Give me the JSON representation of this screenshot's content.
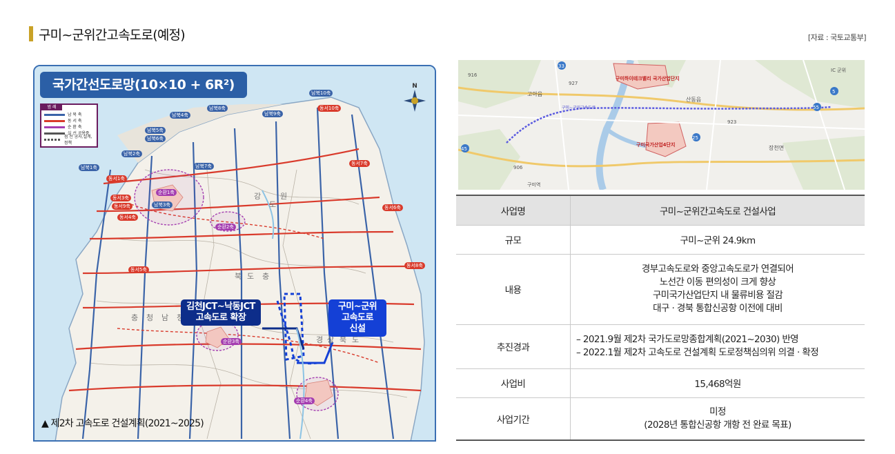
{
  "header": {
    "title": "구미~군위간고속도로(예정)",
    "source": "[자료 : 국토교통부]"
  },
  "left_map": {
    "title": "국가간선도로망(10×10 + 6R²)",
    "compass_label": "N",
    "legend": {
      "heading": "범 례",
      "items": [
        "남 북 축",
        "동 서 축",
        "순 환 축",
        "실 선 공용중",
        "점 선 공사,설계,정책"
      ]
    },
    "region_labels": [
      "강",
      "원",
      "충",
      "청",
      "북",
      "도",
      "충",
      "청",
      "남",
      "도",
      "경",
      "상",
      "북",
      "도"
    ],
    "route_labels": {
      "north_south": [
        "남북1축",
        "남북2축",
        "남북3축",
        "남북4축",
        "남북5축",
        "남북6축",
        "남북7축",
        "남북8축",
        "남북9축",
        "남북10축"
      ],
      "east_west": [
        "동서1축",
        "동서3축",
        "동서4축",
        "동서5축",
        "동서6축",
        "동서7축",
        "동서8축",
        "동서9축",
        "동서10축"
      ],
      "ring": [
        "순환1축",
        "순환2축",
        "순환3축",
        "순환4축"
      ]
    },
    "callout_gimcheon": [
      "김천JCT~낙동JCT",
      "고속도로 확장"
    ],
    "callout_gumi": [
      "구미~군위",
      "고속도로",
      "신설"
    ],
    "caption": "▲ 제2차 고속도로 건설계획(2021~2025)",
    "colors": {
      "north_south": "#3a63a8",
      "east_west": "#d93a2b",
      "ring": "#a43db0",
      "header": "#2b5fa6"
    }
  },
  "right_map": {
    "labels": {
      "industrial_5": "구미하이테크밸리 국가산업단지",
      "industrial_4": "구미국가산업4단지",
      "goa": "고아읍",
      "sandong": "산동읍",
      "jangcheon": "장천면",
      "gumi_station": "구미역",
      "gunwi_ic": "IC 군위",
      "road_916": "916",
      "road_927": "927",
      "road_923": "923",
      "road_906": "906",
      "road_55": "55",
      "road_45": "45",
      "road_25": "25",
      "road_33": "33",
      "road_5": "5",
      "route_label": "구미~군위고속도로"
    }
  },
  "table": {
    "rows": [
      {
        "key": "사업명",
        "value": [
          "구미~군위간고속도로 건설사업"
        ]
      },
      {
        "key": "규모",
        "value": [
          "구미~군위 24.9km"
        ]
      },
      {
        "key": "내용",
        "value": [
          "경부고속도로와 중앙고속도로가 연결되어",
          "노선간 이동 편의성이 크게 향상",
          "구미국가산업단지 내 물류비용 절감",
          "대구 · 경북 통합신공항 이전에 대비"
        ]
      },
      {
        "key": "추진경과",
        "value": [
          "– 2021.9월 제2차 국가도로망종합계획(2021~2030) 반영",
          "– 2022.1월 제2차 고속도로 건설계획 도로정책심의위 의결 · 확정"
        ]
      },
      {
        "key": "사업비",
        "value": [
          "15,468억원"
        ]
      },
      {
        "key": "사업기간",
        "value": [
          "미정",
          "(2028년 통합신공항 개항 전 완료 목표)"
        ]
      }
    ]
  }
}
